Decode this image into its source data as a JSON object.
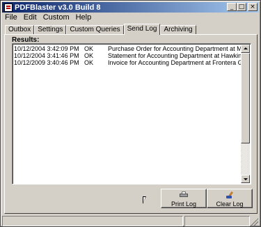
{
  "window": {
    "title": "PDFBlaster v3.0 Build 8",
    "minimize_label": "_",
    "maximize_label": "□",
    "close_label": "×"
  },
  "menu": [
    "File",
    "Edit",
    "Custom",
    "Help"
  ],
  "tabs": [
    {
      "label": "Outbox",
      "active": false
    },
    {
      "label": "Settings",
      "active": false
    },
    {
      "label": "Custom Queries",
      "active": false
    },
    {
      "label": "Send Log",
      "active": true
    },
    {
      "label": "Archiving",
      "active": false
    }
  ],
  "results": {
    "label": "Results:",
    "rows": [
      {
        "date": "10/12/2004 3:42:09 PM",
        "status": "OK",
        "description": "Purchase Order for Accounting Department at Micro Cons"
      },
      {
        "date": "10/12/2004 3:41:46 PM",
        "status": "OK",
        "description": "Statement for Accounting Department at Hawkins Hardwa"
      },
      {
        "date": "10/12/2009 3:40:46 PM",
        "status": "OK",
        "description": "Invoice for Accounting Department at Frontera Group Com"
      }
    ]
  },
  "buttons": {
    "print_log": "Print Log",
    "clear_log": "Clear Log",
    "print_icon": "printer-icon",
    "clear_icon": "brush-icon"
  }
}
